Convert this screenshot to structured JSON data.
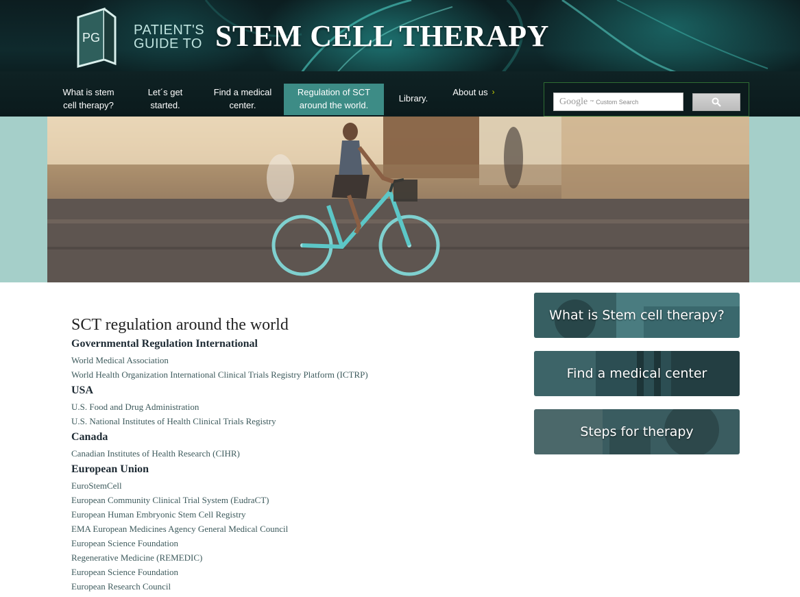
{
  "logo": {
    "monogram": "PG",
    "line1": "PATIENT'S",
    "line2": "GUIDE TO",
    "title": "STEM CELL THERAPY"
  },
  "nav": {
    "items": [
      {
        "line1": "What is stem",
        "line2": "cell therapy?"
      },
      {
        "line1": "Let´s get",
        "line2": "started."
      },
      {
        "line1": "Find a medical",
        "line2": "center."
      },
      {
        "line1": "Regulation of SCT",
        "line2": "around the world.",
        "active": true
      },
      {
        "line1": "Library.",
        "line2": ""
      },
      {
        "line1": "About us",
        "line2": ""
      }
    ],
    "about_chevron": "›"
  },
  "search": {
    "brand": "Google",
    "tm": "™",
    "placeholder": "Custom Search"
  },
  "content": {
    "title": "SCT regulation around the world",
    "sections": [
      {
        "heading": "Governmental Regulation International",
        "links": [
          "World Medical Association",
          "World Health Organization International Clinical Trials Registry Platform (ICTRP)"
        ]
      },
      {
        "heading": "USA",
        "links": [
          "U.S. Food and Drug Administration",
          "U.S. National Institutes of Health Clinical Trials Registry"
        ]
      },
      {
        "heading": "Canada",
        "links": [
          "Canadian Institutes of Health Research (CIHR)"
        ]
      },
      {
        "heading": "European Union",
        "links": [
          "EuroStemCell",
          "European Community Clinical Trial System (EudraCT)",
          "European Human Embryonic Stem Cell Registry",
          "EMA European Medicines Agency General Medical Council",
          "European Science Foundation",
          "Regenerative Medicine (REMEDIC)",
          "European Science Foundation",
          "European Research Council"
        ]
      }
    ]
  },
  "sidebar": {
    "tiles": [
      "What is Stem cell therapy?",
      "Find a medical center",
      "Steps for therapy"
    ]
  },
  "colors": {
    "nav_active": "#3d8c86",
    "hero_band": "#a5cfc9",
    "link": "#3d5a5c",
    "accent_chevron": "#c6d200"
  }
}
